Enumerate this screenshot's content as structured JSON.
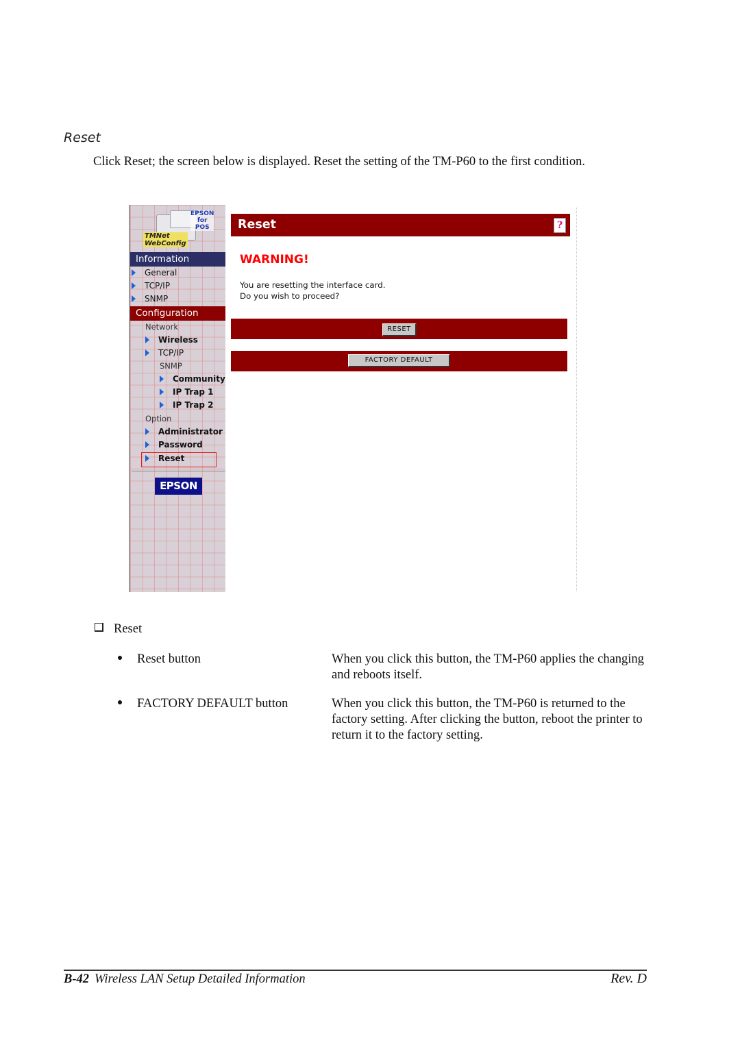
{
  "section_title": "Reset",
  "intro_text": "Click Reset; the screen below is displayed. Reset the setting of the TM-P60 to the first condition.",
  "screenshot": {
    "logo": {
      "brand_small": "EPSON for POS",
      "brand_lines": [
        "EPSON",
        "for",
        "POS"
      ],
      "product_lines": [
        "TMNet",
        "WebConfig"
      ]
    },
    "sidebar": {
      "information_header": "Information",
      "information_items": [
        "General",
        "TCP/IP",
        "SNMP"
      ],
      "configuration_header": "Configuration",
      "network_label": "Network",
      "network_items": [
        "Wireless",
        "TCP/IP"
      ],
      "snmp_label": "SNMP",
      "snmp_items": [
        "Community",
        "IP Trap 1",
        "IP Trap 2"
      ],
      "option_label": "Option",
      "option_items": [
        "Administrator",
        "Password",
        "Reset"
      ],
      "selected_item": "Reset",
      "footer_logo": "EPSON"
    },
    "page": {
      "title": "Reset",
      "help_icon": "?",
      "warning": "WARNING!",
      "message_lines": [
        "You are resetting the interface card.",
        "Do you wish to proceed?"
      ],
      "reset_button": "RESET",
      "factory_default_button": "FACTORY DEFAULT"
    },
    "colors": {
      "title_bar": "#8e0000",
      "info_header": "#2b2f66",
      "config_header": "#8c0000",
      "warning": "#ff0000",
      "nav_arrow": "#1b62d8"
    }
  },
  "list": {
    "heading": "Reset",
    "items": [
      {
        "term": "Reset button",
        "description": "When you click this button, the TM-P60 applies the changing and reboots itself."
      },
      {
        "term": "FACTORY DEFAULT button",
        "description": "When you click this button, the TM-P60 is returned to the factory setting. After clicking the button, reboot the printer to return it to the factory setting."
      }
    ]
  },
  "footer": {
    "page_number": "B-42",
    "chapter": "Wireless LAN Setup Detailed Information",
    "revision": "Rev. D"
  }
}
